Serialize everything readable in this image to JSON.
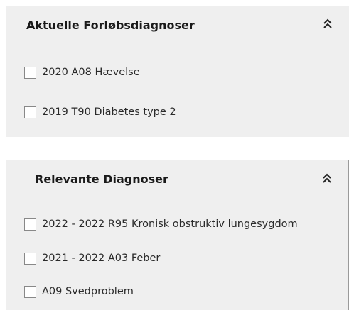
{
  "panels": [
    {
      "title": "Aktuelle Forløbsdiagnoser",
      "collapse_icon": "double-chevron-up-icon",
      "items": [
        {
          "label": "2020 A08 Hævelse",
          "checked": false
        },
        {
          "label": "2019 T90 Diabetes type 2",
          "checked": false
        }
      ]
    },
    {
      "title": "Relevante Diagnoser",
      "collapse_icon": "double-chevron-up-icon",
      "items": [
        {
          "label": "2022 - 2022 R95 Kronisk obstruktiv lungesygdom",
          "checked": false
        },
        {
          "label": "2021 - 2022 A03 Feber",
          "checked": false
        },
        {
          "label": "A09 Svedproblem",
          "checked": false
        }
      ]
    }
  ]
}
